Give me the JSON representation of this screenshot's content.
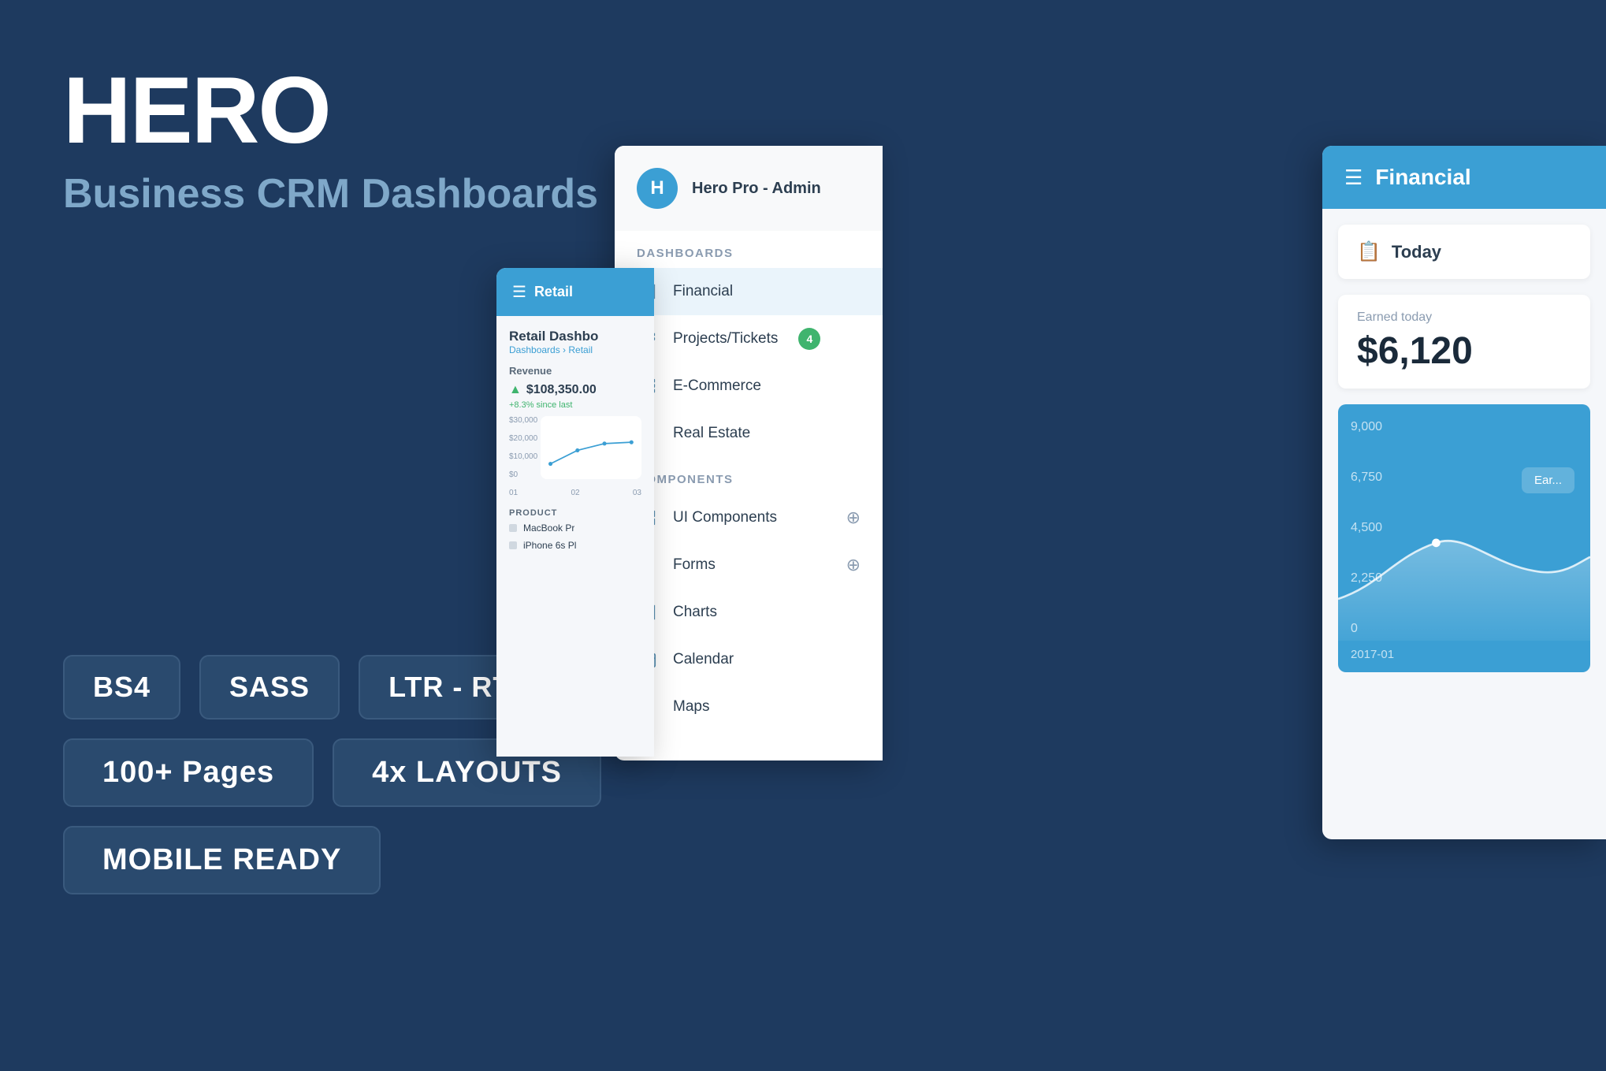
{
  "hero": {
    "title": "HERO",
    "subtitle": "Business CRM Dashboards"
  },
  "badges": {
    "row1": [
      "BS4",
      "SASS",
      "LTR - RTL"
    ],
    "row2": [
      "100+ Pages",
      "4x LAYOUTS"
    ],
    "row3": [
      "MOBILE READY"
    ]
  },
  "sidebar": {
    "user": {
      "avatar_letter": "H",
      "username": "Hero Pro - Admin"
    },
    "sections": {
      "dashboards_label": "Dashboards",
      "components_label": "Components"
    },
    "dashboard_items": [
      {
        "label": "Financial",
        "icon": "bar-chart",
        "active": true
      },
      {
        "label": "Projects/Tickets",
        "icon": "ticket",
        "badge": "4"
      },
      {
        "label": "E-Commerce",
        "icon": "store"
      },
      {
        "label": "Real Estate",
        "icon": "building"
      }
    ],
    "component_items": [
      {
        "label": "UI Components",
        "icon": "grid",
        "expand": true
      },
      {
        "label": "Forms",
        "icon": "form",
        "expand": true
      },
      {
        "label": "Charts",
        "icon": "bar-chart"
      },
      {
        "label": "Calendar",
        "icon": "calendar"
      },
      {
        "label": "Maps",
        "icon": "map"
      }
    ]
  },
  "retail": {
    "header_title": "Retail",
    "dashboard_title": "Retail Dashbo",
    "breadcrumb": "Dashboards › Retail",
    "revenue_label": "Revenue",
    "amount": "$108,350.00",
    "growth": "+8.3% since last",
    "y_labels": [
      "$30,000",
      "$20,000",
      "$10,000",
      "$0"
    ],
    "x_labels": [
      "01",
      "02",
      "03"
    ],
    "product_label": "PRODUCT",
    "products": [
      "MacBook Pr",
      "iPhone 6s Pl"
    ]
  },
  "financial": {
    "header_title": "Financial",
    "today_label": "Today",
    "earned_label": "Earned today",
    "earned_value": "$6,120",
    "chart": {
      "y_labels": [
        "9,000",
        "6,750",
        "4,500",
        "2,250",
        "0"
      ],
      "x_label": "2017-01",
      "tooltip_label": "Ear..."
    }
  }
}
